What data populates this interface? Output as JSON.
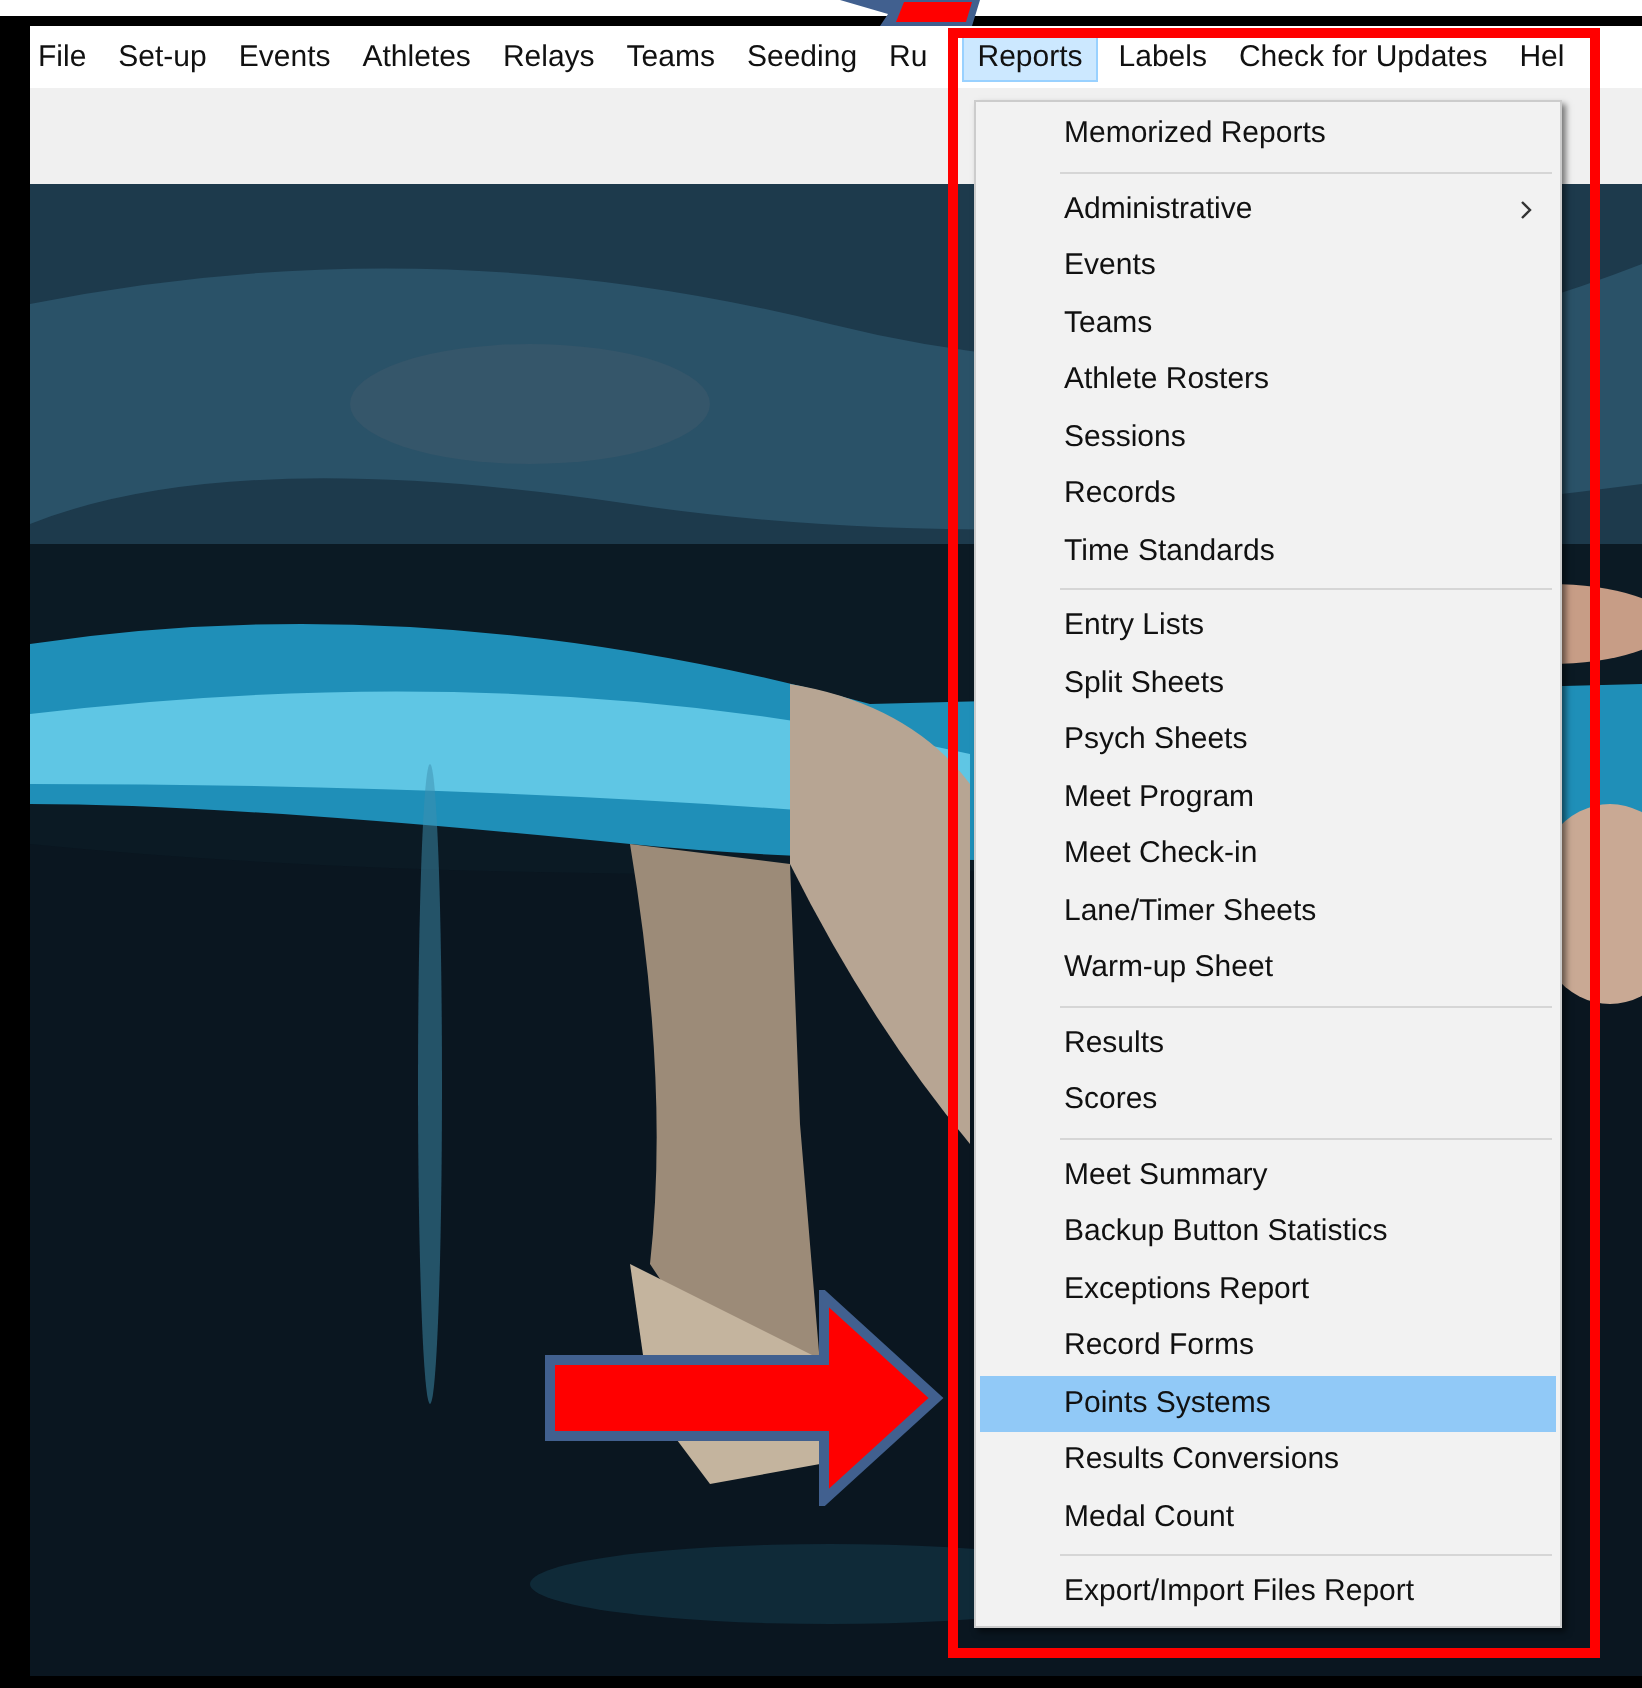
{
  "menu_bar": [
    {
      "label": "File",
      "selected": false
    },
    {
      "label": "Set-up",
      "selected": false
    },
    {
      "label": "Events",
      "selected": false
    },
    {
      "label": "Athletes",
      "selected": false
    },
    {
      "label": "Relays",
      "selected": false
    },
    {
      "label": "Teams",
      "selected": false
    },
    {
      "label": "Seeding",
      "selected": false
    },
    {
      "label": "Ru",
      "selected": false
    },
    {
      "label": "Reports",
      "selected": true
    },
    {
      "label": "Labels",
      "selected": false
    },
    {
      "label": "Check for Updates",
      "selected": false
    },
    {
      "label": "Hel",
      "selected": false
    }
  ],
  "background": {
    "kind": "picture"
  },
  "reports_menu": [
    [
      {
        "label": "Memorized Reports",
        "selected": false,
        "submenu": false
      }
    ],
    [
      {
        "label": "Administrative",
        "selected": false,
        "submenu": true
      },
      {
        "label": "Events",
        "selected": false,
        "submenu": false
      },
      {
        "label": "Teams",
        "selected": false,
        "submenu": false
      },
      {
        "label": "Athlete Rosters",
        "selected": false,
        "submenu": false
      },
      {
        "label": "Sessions",
        "selected": false,
        "submenu": false
      },
      {
        "label": "Records",
        "selected": false,
        "submenu": false
      },
      {
        "label": "Time Standards",
        "selected": false,
        "submenu": false
      }
    ],
    [
      {
        "label": "Entry Lists",
        "selected": false,
        "submenu": false
      },
      {
        "label": "Split Sheets",
        "selected": false,
        "submenu": false
      },
      {
        "label": "Psych Sheets",
        "selected": false,
        "submenu": false
      },
      {
        "label": "Meet Program",
        "selected": false,
        "submenu": false
      },
      {
        "label": "Meet Check-in",
        "selected": false,
        "submenu": false
      },
      {
        "label": "Lane/Timer Sheets",
        "selected": false,
        "submenu": false
      },
      {
        "label": "Warm-up Sheet",
        "selected": false,
        "submenu": false
      }
    ],
    [
      {
        "label": "Results",
        "selected": false,
        "submenu": false
      },
      {
        "label": "Scores",
        "selected": false,
        "submenu": false
      }
    ],
    [
      {
        "label": "Meet Summary",
        "selected": false,
        "submenu": false
      },
      {
        "label": "Backup Button Statistics",
        "selected": false,
        "submenu": false
      },
      {
        "label": "Exceptions Report",
        "selected": false,
        "submenu": false
      },
      {
        "label": "Record Forms",
        "selected": false,
        "submenu": false
      },
      {
        "label": "Points Systems",
        "selected": true,
        "submenu": false
      },
      {
        "label": "Results Conversions",
        "selected": false,
        "submenu": false
      },
      {
        "label": "Medal Count",
        "selected": false,
        "submenu": false
      }
    ],
    [
      {
        "label": "Export/Import Files Report",
        "selected": false,
        "submenu": false
      }
    ]
  ]
}
